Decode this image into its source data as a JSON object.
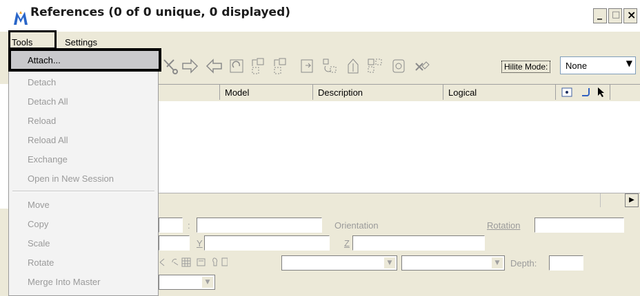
{
  "window": {
    "title": "References (0 of 0 unique, 0 displayed)",
    "minimize_label": "_",
    "maximize_label": "□",
    "close_label": "×"
  },
  "menubar": {
    "tools": "Tools",
    "settings": "Settings"
  },
  "tools_menu": {
    "items": [
      {
        "label": "Attach...",
        "enabled": true,
        "highlighted": true
      },
      {
        "label": "Detach",
        "enabled": false
      },
      {
        "label": "Detach All",
        "enabled": false
      },
      {
        "label": "Reload",
        "enabled": false
      },
      {
        "label": "Reload All",
        "enabled": false
      },
      {
        "label": "Exchange",
        "enabled": false
      },
      {
        "label": "Open in New Session",
        "enabled": false
      },
      {
        "label": "Move",
        "enabled": false
      },
      {
        "label": "Copy",
        "enabled": false
      },
      {
        "label": "Scale",
        "enabled": false
      },
      {
        "label": "Rotate",
        "enabled": false
      },
      {
        "label": "Merge Into Master",
        "enabled": false
      }
    ]
  },
  "toolbar": {
    "hilite_label": "Hilite Mode:",
    "hilite_value": "None"
  },
  "list": {
    "columns": [
      "Model",
      "Description",
      "Logical"
    ]
  },
  "details": {
    "colon": ":",
    "orientation_label": "Orientation",
    "rotation_label": "Rotation",
    "y_label": "Y",
    "z_label": "Z",
    "depth_label": "Depth:"
  },
  "colors": {
    "window_bg": "#ece9d8",
    "disabled_text": "#9a9a9a",
    "highlight_border": "#000000"
  }
}
